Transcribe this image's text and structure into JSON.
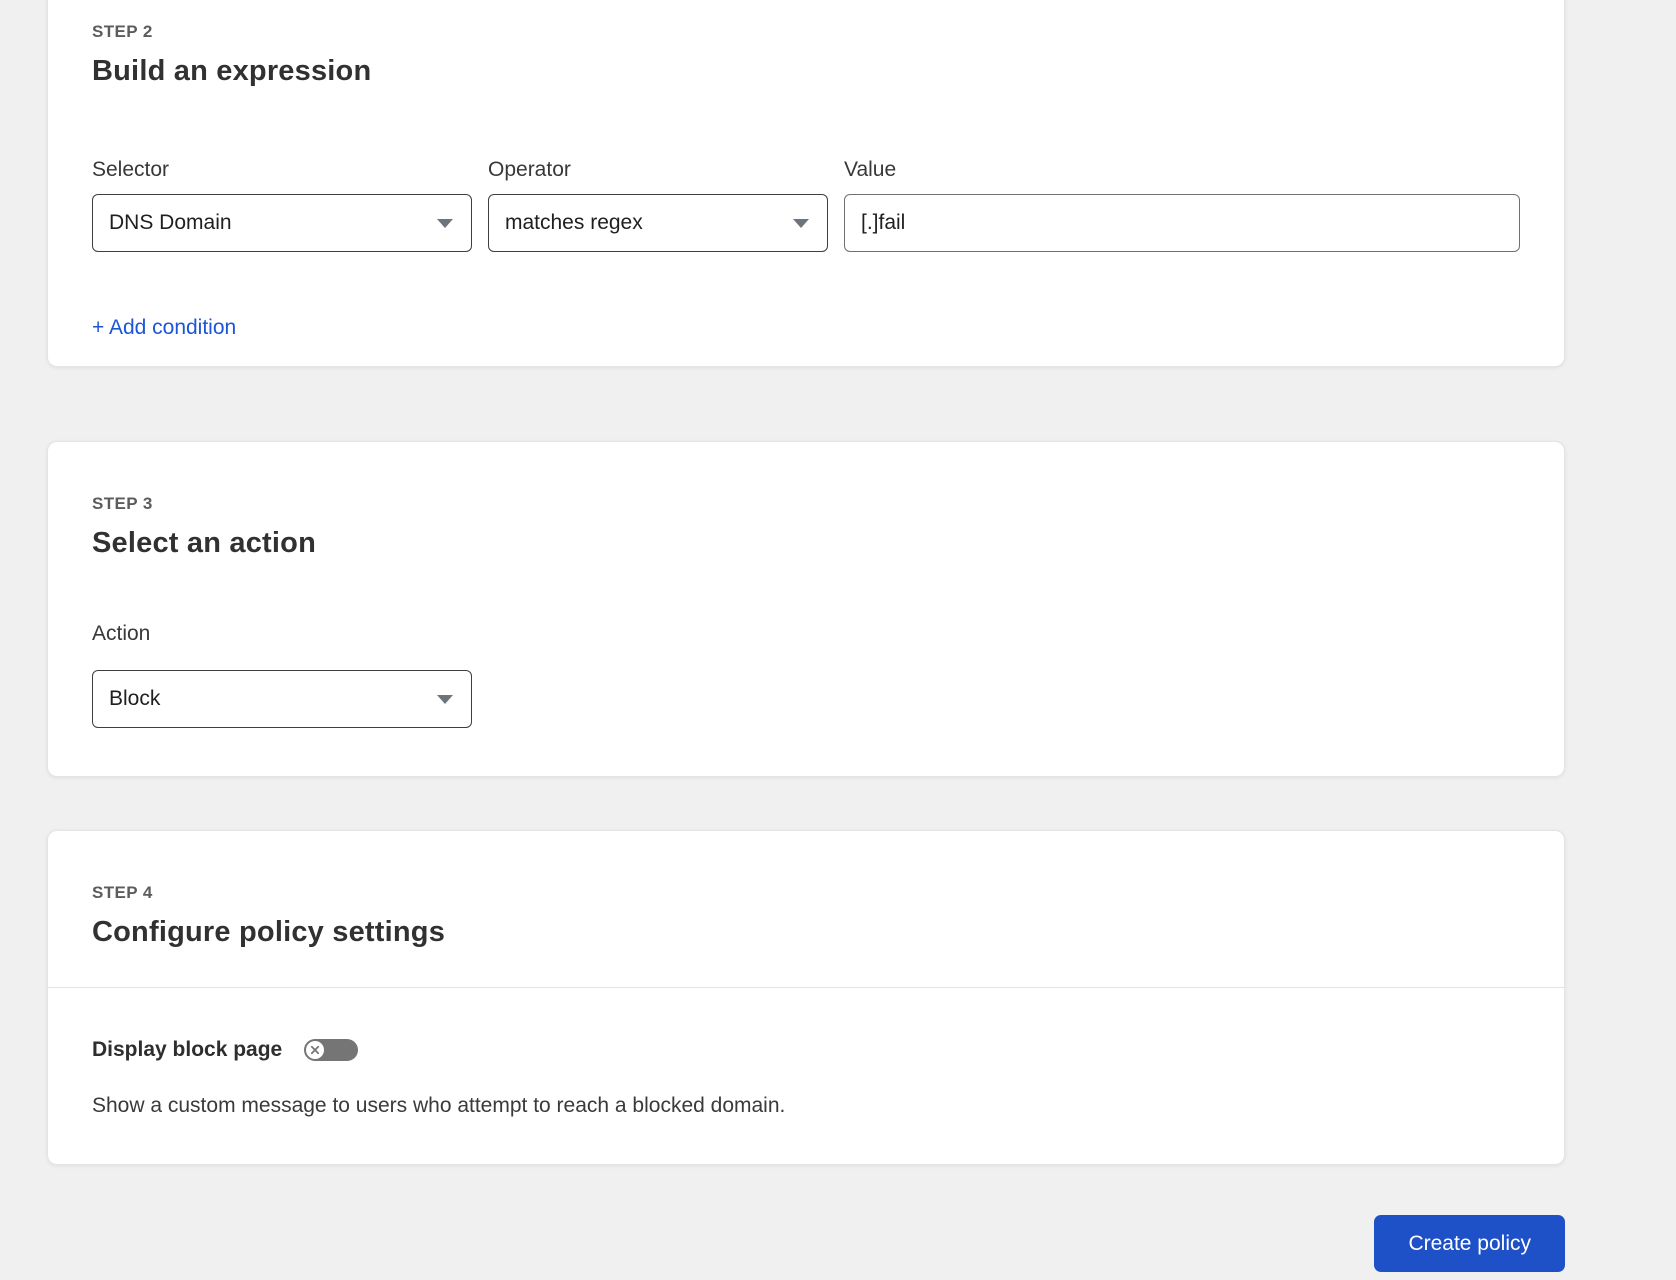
{
  "steps": [
    {
      "step_label": "STEP 2",
      "title": "Build an expression",
      "fields": {
        "selector": {
          "label": "Selector",
          "value": "DNS Domain"
        },
        "operator": {
          "label": "Operator",
          "value": "matches regex"
        },
        "value": {
          "label": "Value",
          "value": "[.]fail"
        }
      },
      "add_condition_label": "+ Add condition"
    },
    {
      "step_label": "STEP 3",
      "title": "Select an action",
      "action": {
        "label": "Action",
        "value": "Block"
      }
    },
    {
      "step_label": "STEP 4",
      "title": "Configure policy settings",
      "settings": {
        "display_block_page": {
          "label": "Display block page",
          "enabled": false,
          "toggle_state": "off",
          "description": "Show a custom message to users who attempt to reach a blocked domain."
        }
      }
    }
  ],
  "footer": {
    "create_policy_label": "Create policy"
  },
  "colors": {
    "page_background": "#f0f0f0",
    "card_background": "#ffffff",
    "link_blue": "#1c55d9",
    "button_blue": "#1e51c8",
    "toggle_off_gray": "#757575",
    "step_label_gray": "#5c5c5c",
    "heading_dark": "#313131"
  }
}
